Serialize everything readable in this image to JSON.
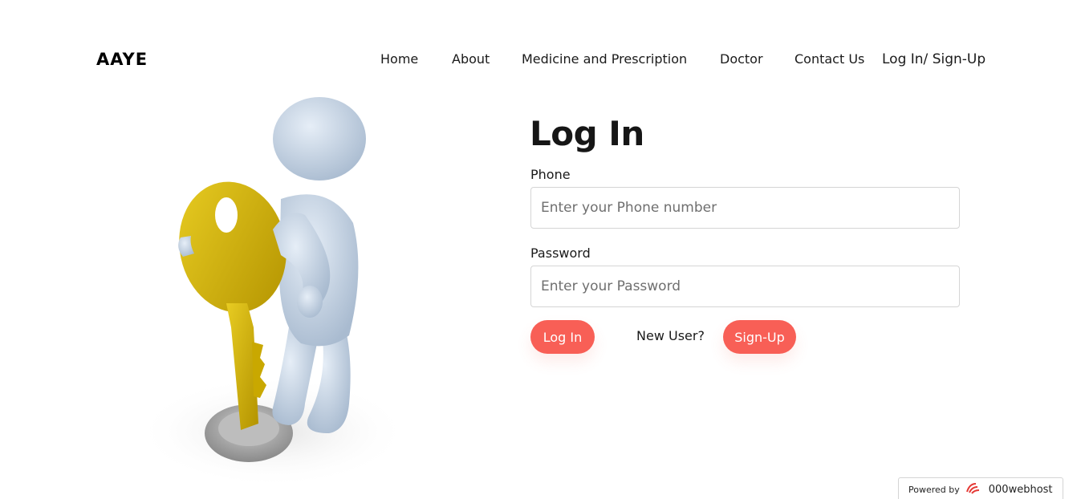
{
  "brand": "AAYE",
  "nav": {
    "home": "Home",
    "about": "About",
    "medicine": "Medicine and Prescription",
    "doctor": "Doctor",
    "contact": "Contact Us",
    "login_signup": "Log In/ Sign-Up"
  },
  "illustration": {
    "icon": "person-holding-key-icon"
  },
  "form": {
    "title": "Log In",
    "phone_label": "Phone",
    "phone_placeholder": "Enter your Phone number",
    "password_label": "Password",
    "password_placeholder": "Enter your Password",
    "login_button": "Log In",
    "new_user_text": "New User?",
    "signup_button": "Sign-Up"
  },
  "badge": {
    "powered_by": "Powered by",
    "host": "000webhost"
  },
  "colors": {
    "accent": "#f85f56",
    "key": "#d9b800",
    "figure": "#c9d6e6"
  }
}
